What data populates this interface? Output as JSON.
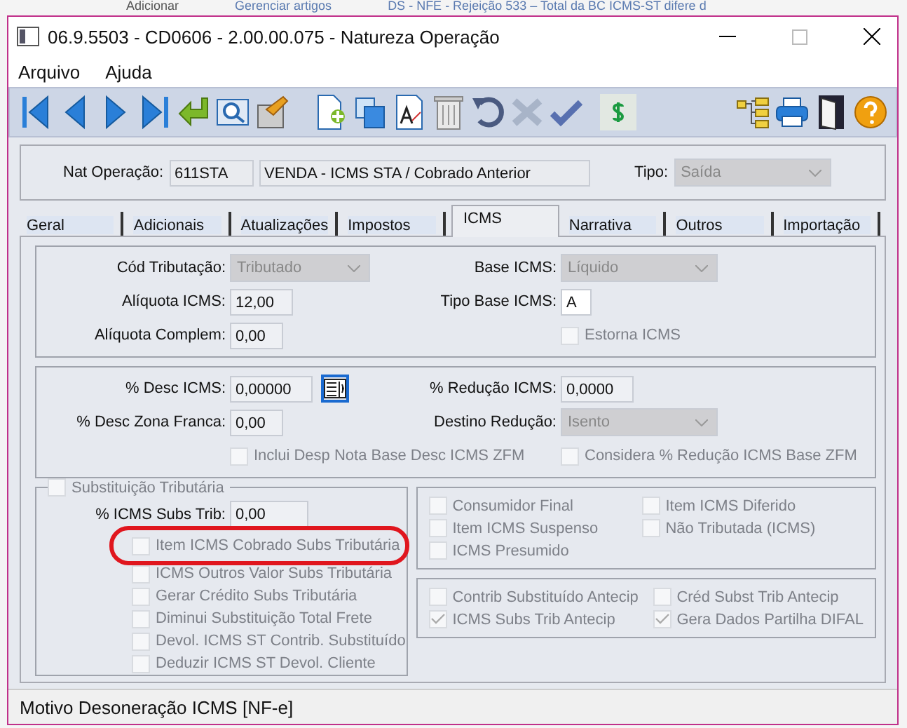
{
  "background_tabs": [
    {
      "label": "Adicionar"
    },
    {
      "label": "Gerenciar artigos"
    },
    {
      "label": "DS - NFE - Rejeição 533 – Total da BC ICMS-ST difere d"
    }
  ],
  "window": {
    "title": "06.9.5503 - CD0606 - 2.00.00.075 - Natureza Operação"
  },
  "menu": [
    "Arquivo",
    "Ajuda"
  ],
  "header": {
    "nat_label": "Nat Operação:",
    "code": "611STA",
    "description": "VENDA - ICMS STA / Cobrado Anterior",
    "tipo_label": "Tipo:",
    "tipo_value": "Saída",
    "tipo_disabled": true
  },
  "tabs": [
    {
      "label": "Geral",
      "selected": false
    },
    {
      "label": "Adicionais",
      "selected": false
    },
    {
      "label": "Atualizações",
      "selected": false
    },
    {
      "label": "Impostos",
      "selected": false
    },
    {
      "label": "ICMS",
      "selected": true
    },
    {
      "label": "Narrativa",
      "selected": false
    },
    {
      "label": "Outros",
      "selected": false
    },
    {
      "label": "Importação",
      "selected": false
    }
  ],
  "groups": [
    [
      [
        {
          "kind": "select",
          "label": "Cód Tributação:",
          "value": "Tributado",
          "disabled": true
        },
        {
          "kind": "select",
          "label": "Base ICMS:",
          "value": "Líquido",
          "disabled": true
        }
      ],
      [
        {
          "kind": "input",
          "label": "Alíquota ICMS:",
          "value": "12,00",
          "disabled": true
        },
        {
          "kind": "input",
          "label": "Tipo Base ICMS:",
          "value": "A",
          "disabled": false
        }
      ],
      [
        {
          "kind": "input",
          "label": "Alíquota Complem:",
          "value": "0,00",
          "disabled": true
        },
        {
          "kind": "checkbox",
          "label": "Estorna ICMS",
          "checked": false,
          "disabled": true
        }
      ]
    ],
    [
      [
        {
          "kind": "input",
          "label": "% Desc ICMS:",
          "value": "0,00000",
          "disabled": true,
          "lookup": true
        },
        {
          "kind": "input",
          "label": "% Redução ICMS:",
          "value": "0,0000",
          "disabled": true
        }
      ],
      [
        {
          "kind": "input",
          "label": "% Desc Zona Franca:",
          "value": "0,00",
          "disabled": true
        },
        {
          "kind": "select",
          "label": "Destino Redução:",
          "value": "Isento",
          "disabled": true
        }
      ],
      [
        {
          "kind": "checkbox",
          "label": "Inclui Desp Nota Base Desc ICMS ZFM",
          "checked": false,
          "disabled": true
        },
        {
          "kind": "checkbox",
          "label": "Considera % Redução ICMS Base ZFM",
          "checked": false,
          "disabled": true
        }
      ]
    ]
  ],
  "st": {
    "title": {
      "label": "Substituição Tributária",
      "checked": false,
      "disabled": true
    },
    "field_label": "% ICMS Subs Trib:",
    "field_value": "0,00",
    "options": [
      {
        "label": "Item ICMS Cobrado Subs Tributária",
        "checked": false,
        "disabled": true
      },
      {
        "label": "ICMS Outros Valor Subs Tributária",
        "checked": false,
        "disabled": true
      },
      {
        "label": "Gerar Crédito Subs Tributária",
        "checked": false,
        "disabled": true
      },
      {
        "label": "Diminui Substituição Total Frete",
        "checked": false,
        "disabled": true
      },
      {
        "label": "Devol. ICMS ST Contrib. Substituído",
        "checked": false,
        "disabled": true
      },
      {
        "label": "Deduzir ICMS ST Devol. Cliente",
        "checked": false,
        "disabled": true
      }
    ]
  },
  "flags": [
    [
      {
        "label": "Consumidor Final",
        "checked": false,
        "disabled": true
      },
      {
        "label": "Item ICMS Diferido",
        "checked": false,
        "disabled": true
      },
      {
        "label": "Item ICMS Suspenso",
        "checked": false,
        "disabled": true
      },
      {
        "label": "Não Tributada (ICMS)",
        "checked": false,
        "disabled": true
      },
      {
        "label": "ICMS Presumido",
        "checked": false,
        "disabled": true
      }
    ],
    [
      {
        "label": "Contrib Substituído Antecip",
        "checked": false,
        "disabled": true
      },
      {
        "label": "Créd Subst Trib Antecip",
        "checked": false,
        "disabled": true
      },
      {
        "label": "ICMS Subs Trib Antecip",
        "checked": true,
        "disabled": true
      },
      {
        "label": "Gera Dados Partilha DIFAL",
        "checked": true,
        "disabled": true
      }
    ]
  ],
  "status_bar": "Motivo Desoneração ICMS [NF-e]"
}
